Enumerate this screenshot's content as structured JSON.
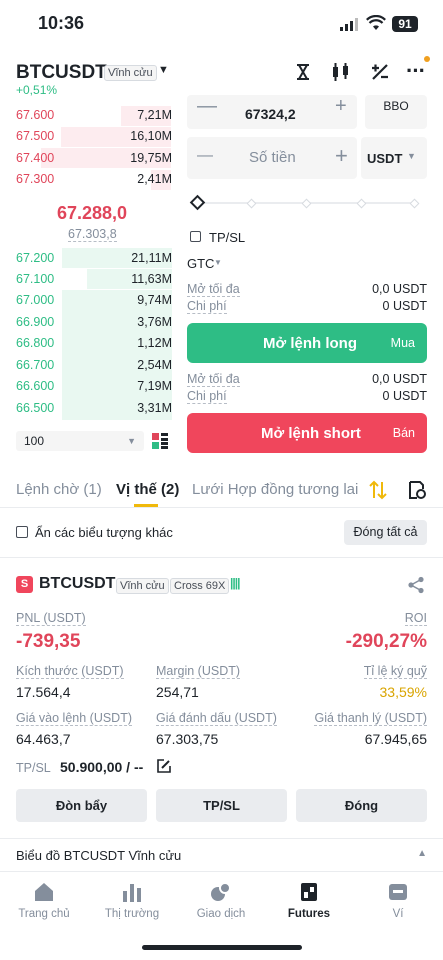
{
  "status": {
    "time": "10:36",
    "battery": "91"
  },
  "header": {
    "pair": "BTCUSDT",
    "contract_type": "Vĩnh cửu",
    "change": "+0,51%"
  },
  "orderbook": {
    "asks": [
      {
        "price": "67.600",
        "qty": "7,21M",
        "depth": 0.3
      },
      {
        "price": "67.500",
        "qty": "16,10M",
        "depth": 0.7
      },
      {
        "price": "67.400",
        "qty": "19,75M",
        "depth": 0.85
      },
      {
        "price": "67.300",
        "qty": "2,41M",
        "depth": 0.12
      }
    ],
    "last_price": "67.288,0",
    "mark_price": "67.303,8",
    "bids": [
      {
        "price": "67.200",
        "qty": "21,11M",
        "depth": 0.9
      },
      {
        "price": "67.100",
        "qty": "11,63M",
        "depth": 0.55
      },
      {
        "price": "67.000",
        "qty": "9,74M",
        "depth": 0.75
      },
      {
        "price": "66.900",
        "qty": "3,76M",
        "depth": 0.75
      },
      {
        "price": "66.800",
        "qty": "1,12M",
        "depth": 0.75
      },
      {
        "price": "66.700",
        "qty": "2,54M",
        "depth": 0.75
      },
      {
        "price": "66.600",
        "qty": "7,19M",
        "depth": 0.75
      },
      {
        "price": "66.500",
        "qty": "3,31M",
        "depth": 0.75
      }
    ],
    "depth_select": "100"
  },
  "form": {
    "price_value": "67324,2",
    "bbo": "BBO",
    "amount_placeholder": "Số tiền",
    "amount_unit": "USDT",
    "tpsl": "TP/SL",
    "tif": "GTC",
    "long": {
      "max_label": "Mở tối đa",
      "max_value": "0,0 USDT",
      "cost_label": "Chi phí",
      "cost_value": "0 USDT",
      "button": "Mở lệnh long",
      "side": "Mua"
    },
    "short": {
      "max_label": "Mở tối đa",
      "max_value": "0,0 USDT",
      "cost_label": "Chi phí",
      "cost_value": "0 USDT",
      "button": "Mở lệnh short",
      "side": "Bán"
    }
  },
  "tabs": {
    "orders": "Lệnh chờ (1)",
    "positions": "Vị thế (2)",
    "grid": "Lưới Hợp đồng tương lai"
  },
  "filter": {
    "hide_label": "Ẩn các biểu tượng khác",
    "close_all": "Đóng tất cả"
  },
  "position": {
    "side_badge": "S",
    "symbol": "BTCUSDT",
    "type": "Vĩnh cửu",
    "margin_mode": "Cross 69X",
    "pnl_label": "PNL (USDT)",
    "pnl": "-739,35",
    "roi_label": "ROI",
    "roi": "-290,27%",
    "size_label": "Kích thước (USDT)",
    "size": "17.564,4",
    "margin_label": "Margin (USDT)",
    "margin": "254,71",
    "ratio_label": "Tỉ lệ ký quỹ",
    "ratio": "33,59%",
    "entry_label": "Giá vào lệnh (USDT)",
    "entry": "64.463,7",
    "mark_label": "Giá đánh dấu (USDT)",
    "mark": "67.303,75",
    "liq_label": "Giá thanh lý (USDT)",
    "liq": "67.945,65",
    "tpsl_label": "TP/SL",
    "tpsl": "50.900,00 / --",
    "btn_leverage": "Đòn bẩy",
    "btn_tpsl": "TP/SL",
    "btn_close": "Đóng"
  },
  "chart_bar": {
    "label": "Biểu đồ BTCUSDT Vĩnh cửu"
  },
  "nav": [
    {
      "label": "Trang chủ",
      "icon": "home-icon"
    },
    {
      "label": "Thị trường",
      "icon": "market-icon"
    },
    {
      "label": "Giao dịch",
      "icon": "trade-icon"
    },
    {
      "label": "Futures",
      "icon": "futures-icon"
    },
    {
      "label": "Ví",
      "icon": "wallet-icon"
    }
  ],
  "colors": {
    "red": "#e0455a",
    "green": "#2ebd85",
    "accent": "#f0b90b"
  }
}
